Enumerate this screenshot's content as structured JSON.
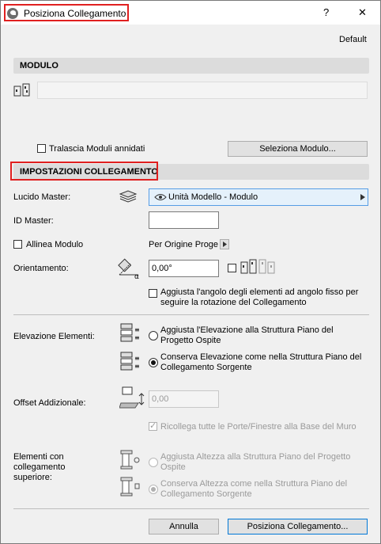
{
  "window": {
    "title": "Posiziona Collegamento",
    "help_label": "?",
    "close_label": "✕"
  },
  "header": {
    "default_label": "Default"
  },
  "modulo": {
    "section_title": "MODULO",
    "skip_nested_label": "Tralascia Moduli annidati",
    "select_button": "Seleziona Modulo..."
  },
  "settings": {
    "section_title": "IMPOSTAZIONI COLLEGAMENTO",
    "master_layer_label": "Lucido Master:",
    "master_layer_value": "Unità Modello - Modulo",
    "master_id_label": "ID Master:",
    "master_id_value": "",
    "align_label": "Allinea Modulo",
    "align_origin_value": "Per Origine Proge",
    "orientation_label": "Orientamento:",
    "orientation_value": "0,00°",
    "adjust_angle_label": "Aggiusta l'angolo degli elementi ad angolo fisso per seguire la rotazione del Collegamento"
  },
  "elevation": {
    "label": "Elevazione Elementi:",
    "option1": "Aggiusta l'Elevazione alla Struttura Piano del Progetto Ospite",
    "option2": "Conserva Elevazione come nella Struttura Piano del Collegamento Sorgente",
    "offset_label": "Offset Addizionale:",
    "offset_value": "0,00",
    "relink_label": "Ricollega tutte le Porte/Finestre alla Base del Muro"
  },
  "top_linked": {
    "label": "Elementi con collegamento superiore:",
    "option1": "Aggiusta Altezza alla Struttura Piano del Progetto Ospite",
    "option2": "Conserva Altezza come nella Struttura Piano del Collegamento Sorgente"
  },
  "footer": {
    "cancel_button": "Annulla",
    "place_button": "Posiziona Collegamento..."
  }
}
